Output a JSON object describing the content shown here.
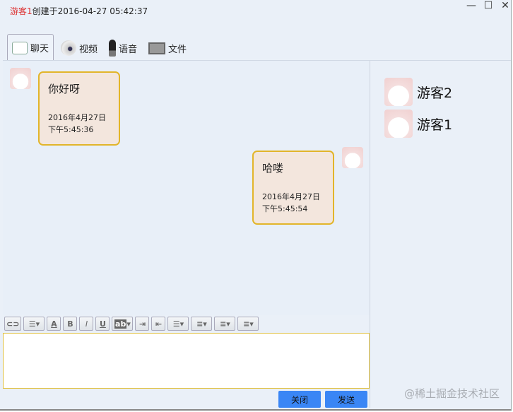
{
  "title": {
    "user": "游客1",
    "rest": "创建于2016-04-27 05:42:37"
  },
  "window_controls": {
    "minimize": "—",
    "maximize": "☐",
    "close": "✕"
  },
  "tabs": [
    {
      "label": "聊天",
      "icon": "chat-icon"
    },
    {
      "label": "视频",
      "icon": "webcam-icon"
    },
    {
      "label": "语音",
      "icon": "microphone-icon"
    },
    {
      "label": "文件",
      "icon": "file-icon"
    }
  ],
  "messages": [
    {
      "side": "left",
      "text": "你好呀",
      "date": "2016年4月27日",
      "time": "下午5:45:36"
    },
    {
      "side": "right",
      "text": "哈喽",
      "date": "2016年4月27日",
      "time": "下午5:45:54"
    }
  ],
  "toolbar": {
    "font_color": "A",
    "bold": "B",
    "italic": "I",
    "underline": "U",
    "highlight": "ab"
  },
  "buttons": {
    "close": "关闭",
    "send": "发送"
  },
  "users": [
    "游客2",
    "游客1"
  ],
  "watermark": "@稀土掘金技术社区",
  "colors": {
    "accent": "#3a86f5",
    "bubble_border": "#e2b52a",
    "bubble_bg": "#f3e6dd"
  }
}
